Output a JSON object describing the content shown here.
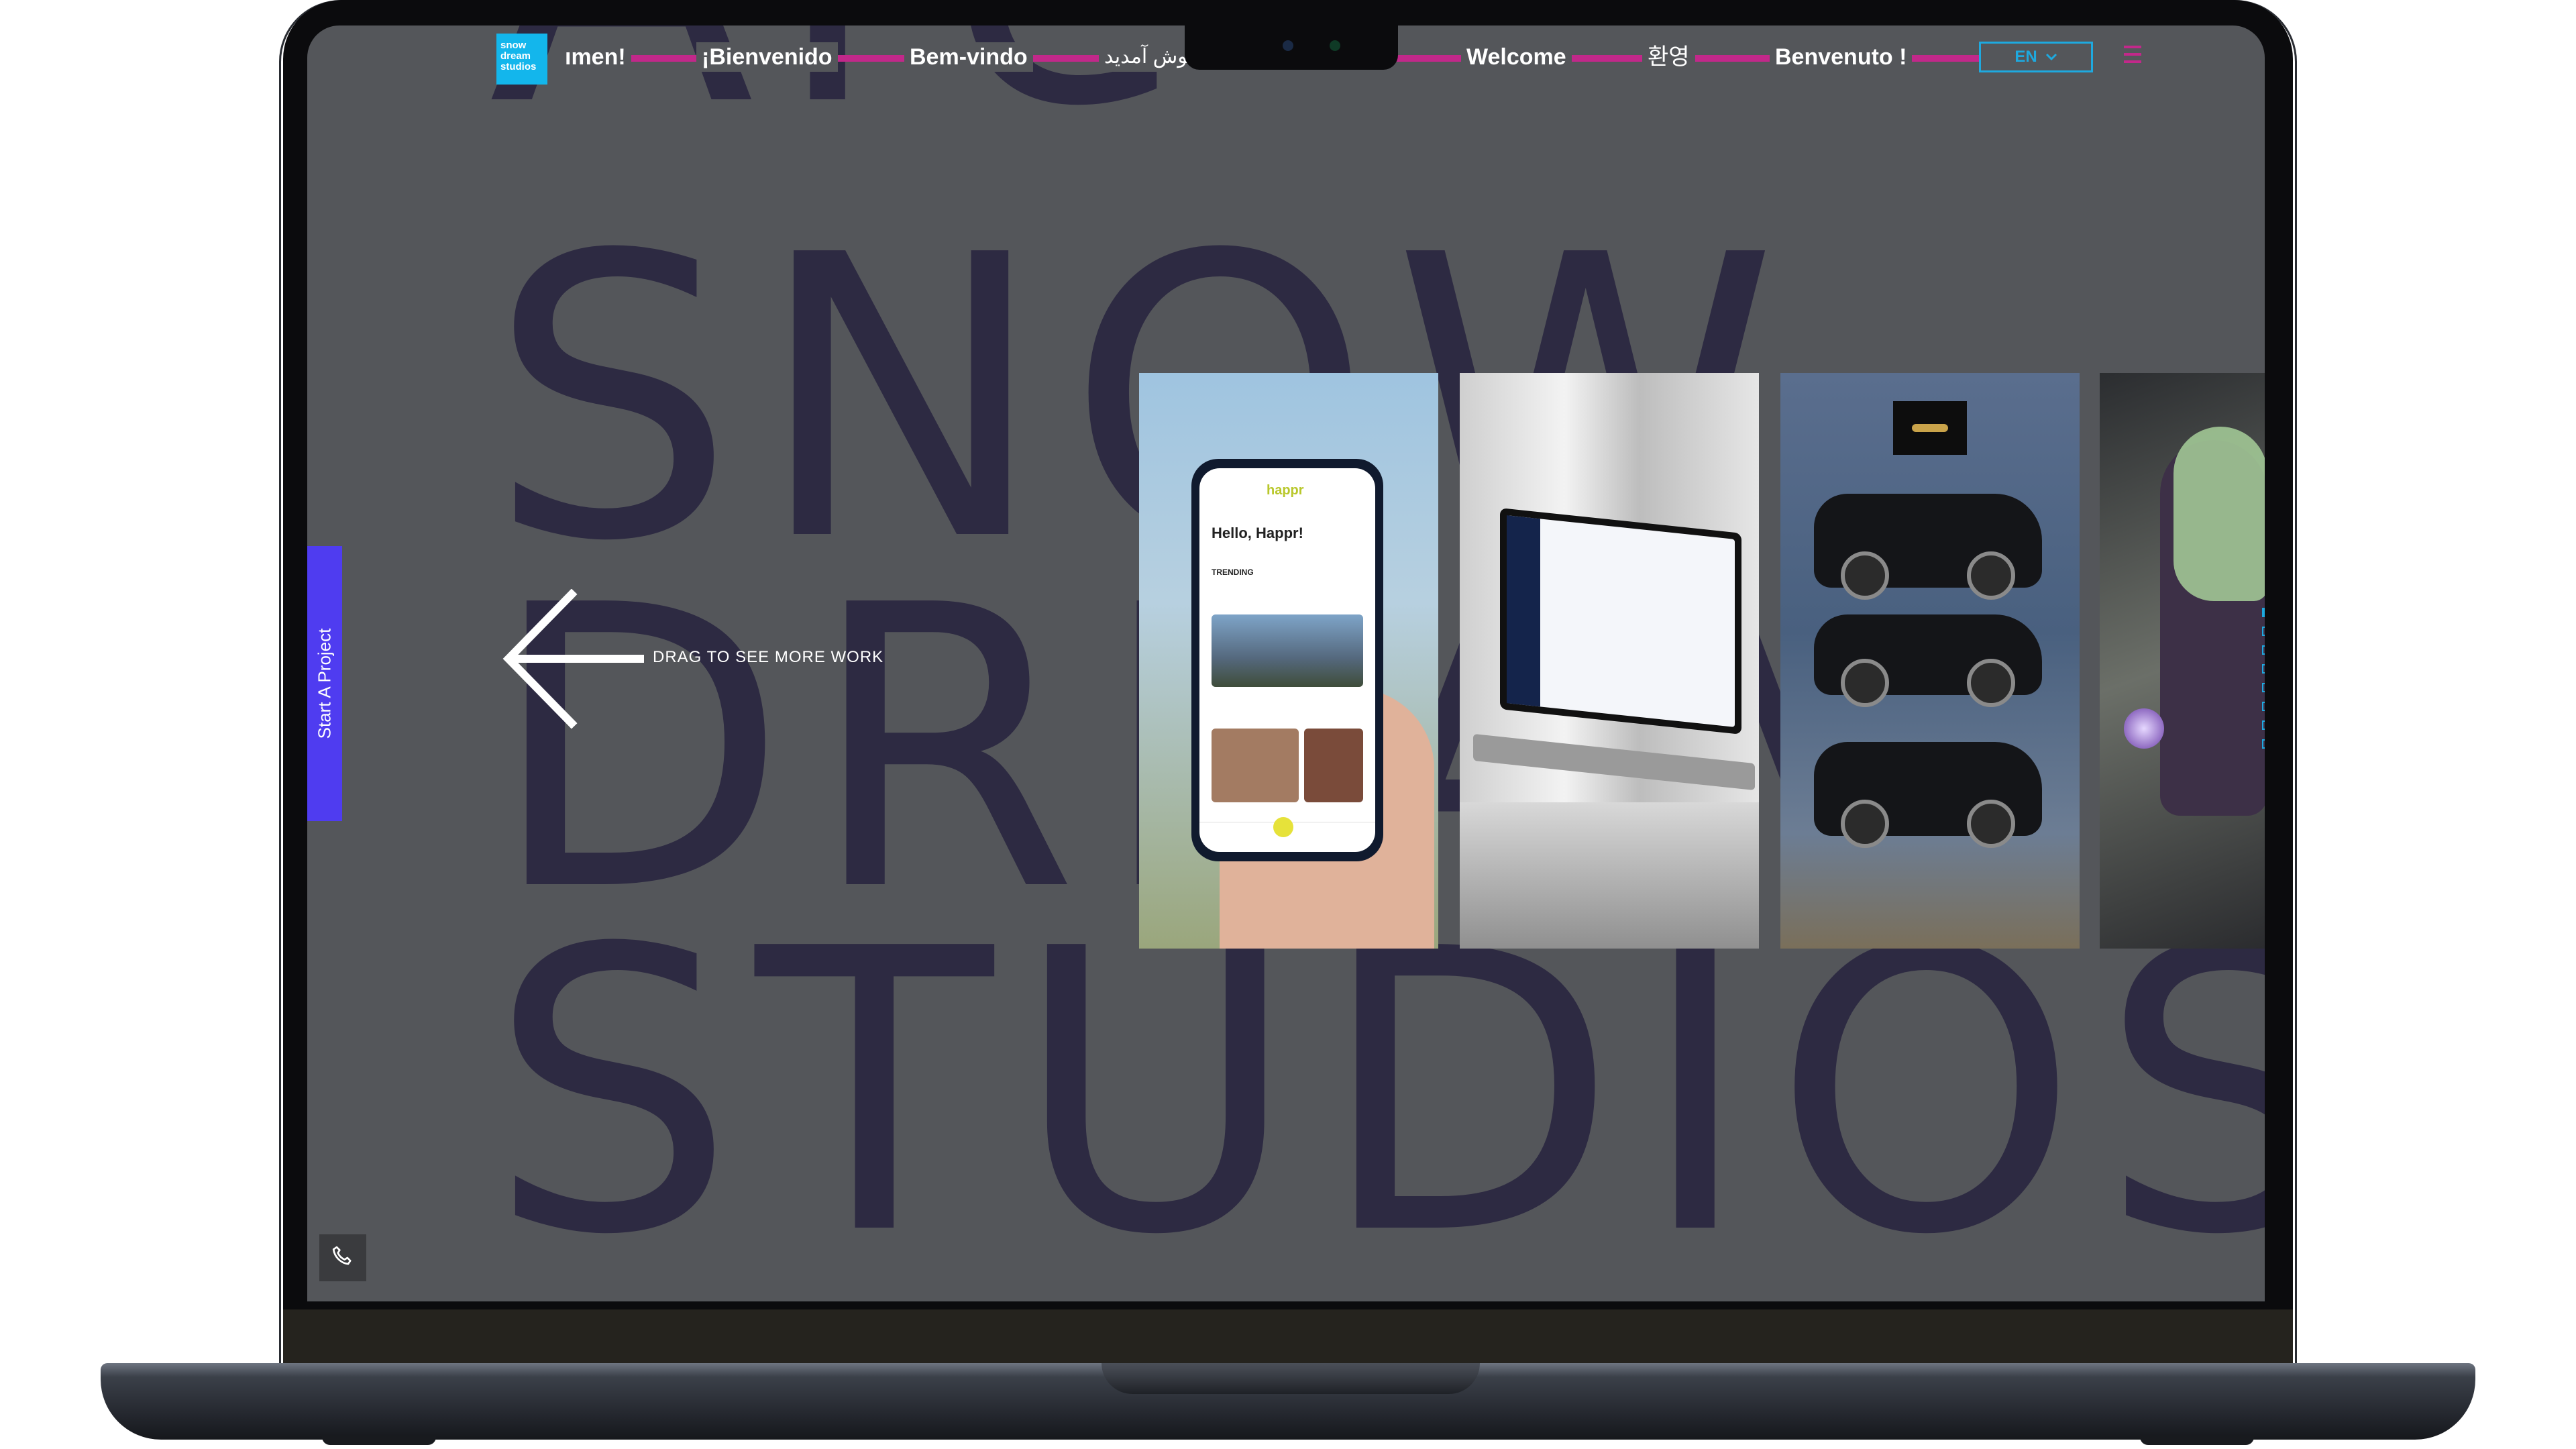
{
  "background_words": [
    "Are",
    "SNOW",
    "DREAM",
    "STUDIOS"
  ],
  "logo": {
    "lines": [
      "snow",
      "dream",
      "studios"
    ]
  },
  "language_greetings": [
    "ımen!",
    "¡Bienvenido",
    "Bem-vindo",
    "خوش آمدید",
    "Welcome",
    "환영",
    "Benvenuto !"
  ],
  "language_selector": {
    "value": "EN"
  },
  "start_project_label": "Start A Project",
  "drag_hint": "DRAG TO SEE MORE WORK",
  "projects": {
    "app": {
      "brand": "happr",
      "greeting": "Hello, Happr!",
      "section": "TRENDING"
    }
  },
  "slider": {
    "count": 8,
    "active_index": 0
  },
  "colors": {
    "accent_pink": "#c2288a",
    "accent_blue": "#1ea9df",
    "cta_purple": "#4f3cf0",
    "logo_blue": "#13b6ec",
    "headline": "#2d2a42"
  },
  "icons": [
    "chevron-down-icon",
    "hamburger-menu-icon",
    "arrow-left-icon",
    "phone-icon"
  ]
}
